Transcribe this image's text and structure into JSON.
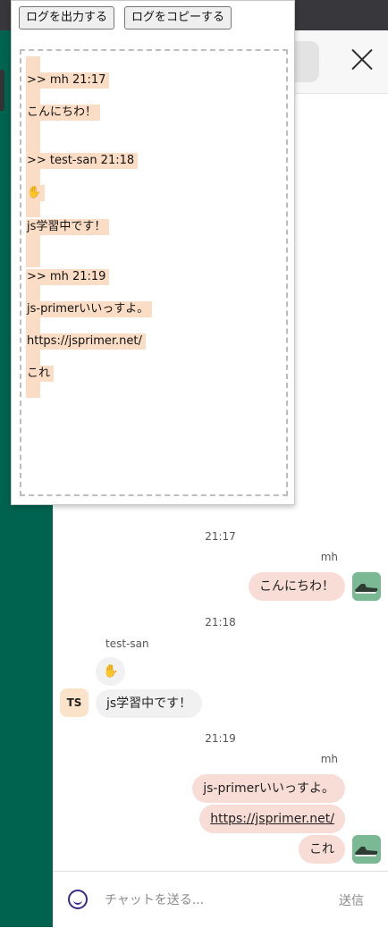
{
  "popup": {
    "export_button": "ログを出力する",
    "copy_button": "ログをコピーする",
    "log_lines": [
      ">> mh 21:17",
      "こんにちわ！",
      ">> test-san 21:18",
      "✋",
      "js学習中です！",
      ">> mh 21:19",
      "js-primerいいっすよ。",
      "https://jsprimer.net/",
      "これ"
    ]
  },
  "chat": {
    "groups": [
      {
        "time": "21:17",
        "sender": "mh",
        "messages": [
          "こんにちわ！"
        ]
      },
      {
        "time": "21:18",
        "sender": "test-san",
        "avatar": "TS",
        "messages": [
          "✋",
          "js学習中です！"
        ]
      },
      {
        "time": "21:19",
        "sender": "mh",
        "messages": [
          "js-primerいいっすよ。",
          "https://jsprimer.net/",
          "これ"
        ]
      }
    ]
  },
  "composer": {
    "placeholder": "チャットを送る...",
    "send_label": "送信",
    "emoji_icon": "smiley-icon"
  },
  "colors": {
    "sidebar": "#00634f",
    "my_bubble": "#f8dcd6",
    "other_bubble": "#f1f1f1",
    "log_highlight": "#fbdcc4"
  }
}
